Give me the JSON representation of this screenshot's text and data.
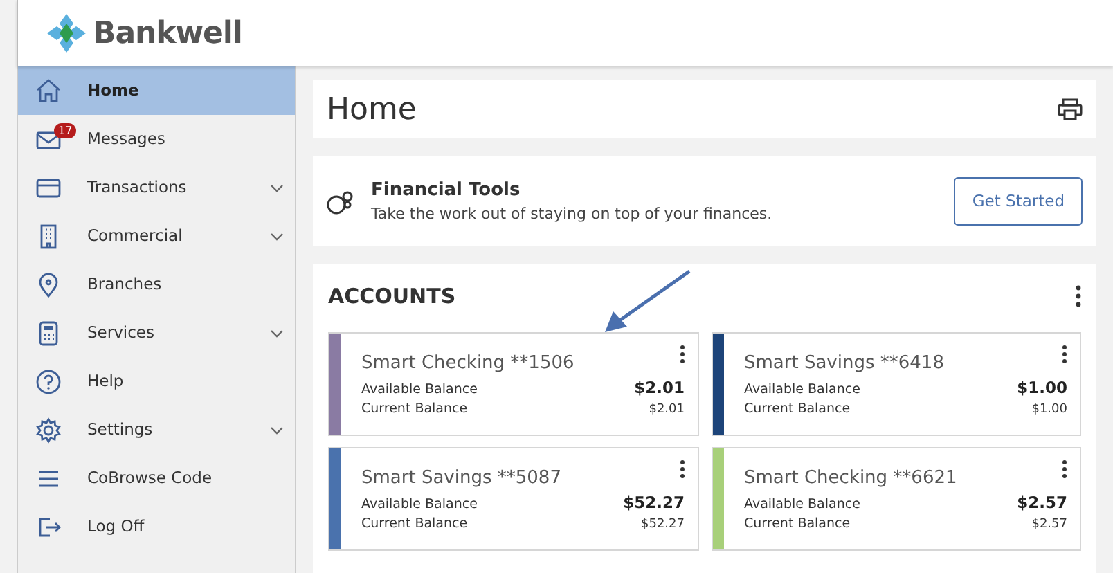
{
  "logo": {
    "text": "Bankwell"
  },
  "sidebar": {
    "items": [
      {
        "label": "Home",
        "selected": true,
        "expandable": false
      },
      {
        "label": "Messages",
        "selected": false,
        "expandable": false,
        "badge": "17"
      },
      {
        "label": "Transactions",
        "selected": false,
        "expandable": true
      },
      {
        "label": "Commercial",
        "selected": false,
        "expandable": true
      },
      {
        "label": "Branches",
        "selected": false,
        "expandable": false
      },
      {
        "label": "Services",
        "selected": false,
        "expandable": true
      },
      {
        "label": "Help",
        "selected": false,
        "expandable": false
      },
      {
        "label": "Settings",
        "selected": false,
        "expandable": true
      },
      {
        "label": "CoBrowse Code",
        "selected": false,
        "expandable": false
      },
      {
        "label": "Log Off",
        "selected": false,
        "expandable": false
      }
    ]
  },
  "page": {
    "title": "Home"
  },
  "financial_tools": {
    "title": "Financial Tools",
    "description": "Take the work out of staying on top of your finances.",
    "button": "Get Started"
  },
  "accounts": {
    "title": "ACCOUNTS",
    "items": [
      {
        "name": "Smart Checking **1506",
        "color": "#8a7ba3",
        "available_label": "Available Balance",
        "available": "$2.01",
        "current_label": "Current Balance",
        "current": "$2.01"
      },
      {
        "name": "Smart Savings **6418",
        "color": "#1d4479",
        "available_label": "Available Balance",
        "available": "$1.00",
        "current_label": "Current Balance",
        "current": "$1.00"
      },
      {
        "name": "Smart Savings **5087",
        "color": "#4a72ad",
        "available_label": "Available Balance",
        "available": "$52.27",
        "current_label": "Current Balance",
        "current": "$52.27"
      },
      {
        "name": "Smart Checking **6621",
        "color": "#a8d07a",
        "available_label": "Available Balance",
        "available": "$2.57",
        "current_label": "Current Balance",
        "current": "$2.57"
      }
    ]
  }
}
